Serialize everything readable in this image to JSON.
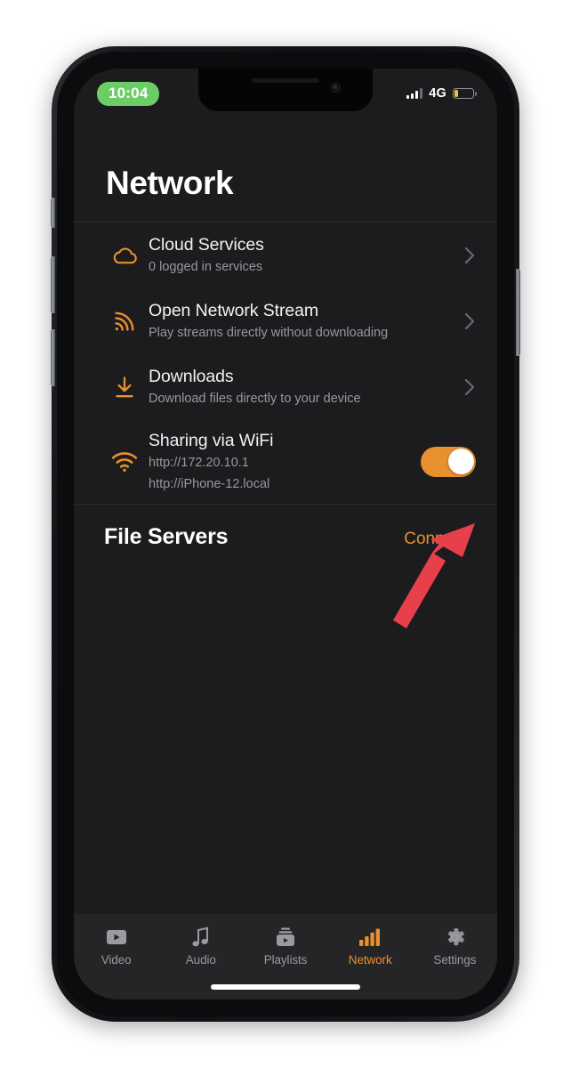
{
  "status_bar": {
    "time": "10:04",
    "time_pill_color": "#6ccd66",
    "network_type": "4G",
    "battery_level_percent": 18,
    "battery_color": "#f2c43d",
    "signal_bars_filled": 3,
    "signal_bars_total": 4
  },
  "header": {
    "title": "Network"
  },
  "theme": {
    "accent": "#e8902e",
    "screen_background": "#1c1c1e",
    "tabbar_background": "#252527",
    "primary_text": "#f2f2f5",
    "secondary_text": "#98989d",
    "annotation_arrow": "#e8404a"
  },
  "rows": [
    {
      "icon": "cloud-icon",
      "title": "Cloud Services",
      "subtitle": "0 logged in services",
      "accessory": "chevron"
    },
    {
      "icon": "stream-rss-icon",
      "title": "Open Network Stream",
      "subtitle": "Play streams directly without downloading",
      "accessory": "chevron"
    },
    {
      "icon": "download-icon",
      "title": "Downloads",
      "subtitle": "Download files directly to your device",
      "accessory": "chevron"
    },
    {
      "icon": "wifi-icon",
      "title": "Sharing via WiFi",
      "subtitle": "http://172.20.10.1",
      "subtitle2": "http://iPhone-12.local",
      "accessory": "toggle",
      "toggle_on": true
    }
  ],
  "file_servers": {
    "title": "File Servers",
    "action_label": "Connect"
  },
  "tabs": [
    {
      "label": "Video",
      "icon": "video-play-icon",
      "active": false
    },
    {
      "label": "Audio",
      "icon": "music-note-icon",
      "active": false
    },
    {
      "label": "Playlists",
      "icon": "playlists-icon",
      "active": false
    },
    {
      "label": "Network",
      "icon": "signal-bars-icon",
      "active": true
    },
    {
      "label": "Settings",
      "icon": "gear-icon",
      "active": false
    }
  ]
}
